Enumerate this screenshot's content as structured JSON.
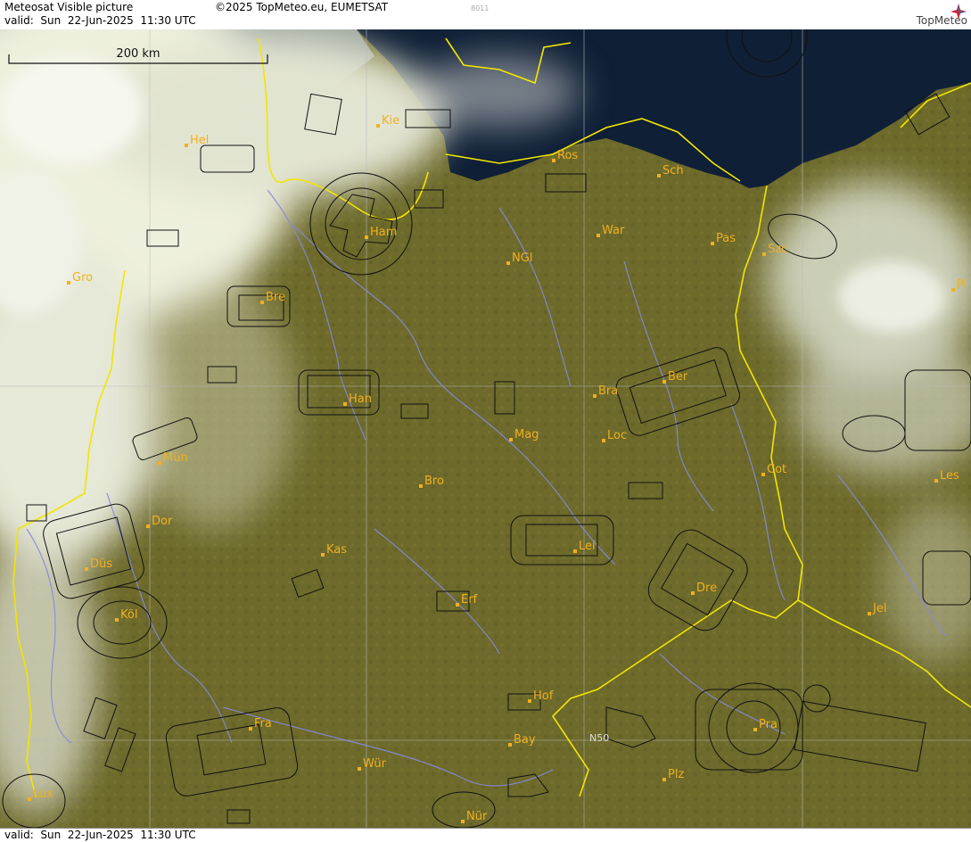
{
  "header": {
    "product_title": "Meteosat Visible picture",
    "copyright": "©2025 TopMeteo.eu, EUMETSAT",
    "code": "8011",
    "valid": "valid:  Sun  22-Jun-2025  11:30 UTC",
    "logo_text": "TopMeteo"
  },
  "footer": {
    "valid": "valid:  Sun  22-Jun-2025  11:30 UTC"
  },
  "scale_bar": {
    "label": "200 km"
  },
  "colors": {
    "land": "#6e6a2a",
    "sea": "#0e1e35",
    "cloud": "#e8ecd8",
    "border": "#f2e600",
    "river": "#8a8ce8",
    "airspace": "#111111",
    "label": "#f0b020"
  },
  "cities": [
    {
      "name": "Kie"
    },
    {
      "name": "Hel"
    },
    {
      "name": "Ros"
    },
    {
      "name": "Sch"
    },
    {
      "name": "Ham"
    },
    {
      "name": "War"
    },
    {
      "name": "Pas"
    },
    {
      "name": "Szc"
    },
    {
      "name": "NGl"
    },
    {
      "name": "Gro"
    },
    {
      "name": "Bre"
    },
    {
      "name": "Pi"
    },
    {
      "name": "Ber"
    },
    {
      "name": "Bra"
    },
    {
      "name": "Han"
    },
    {
      "name": "Mag"
    },
    {
      "name": "Loc"
    },
    {
      "name": "Mün"
    },
    {
      "name": "Cot"
    },
    {
      "name": "Les"
    },
    {
      "name": "Bro"
    },
    {
      "name": "Dor"
    },
    {
      "name": "Kas"
    },
    {
      "name": "Lei"
    },
    {
      "name": "Düs"
    },
    {
      "name": "Dre"
    },
    {
      "name": "Erf"
    },
    {
      "name": "Köl"
    },
    {
      "name": "Jel"
    },
    {
      "name": "Hof"
    },
    {
      "name": "Fra"
    },
    {
      "name": "Pra"
    },
    {
      "name": "Bay"
    },
    {
      "name": "Wür"
    },
    {
      "name": "Plz"
    },
    {
      "name": "Lux"
    },
    {
      "name": "Nür"
    }
  ],
  "marker": {
    "label": "N50"
  }
}
